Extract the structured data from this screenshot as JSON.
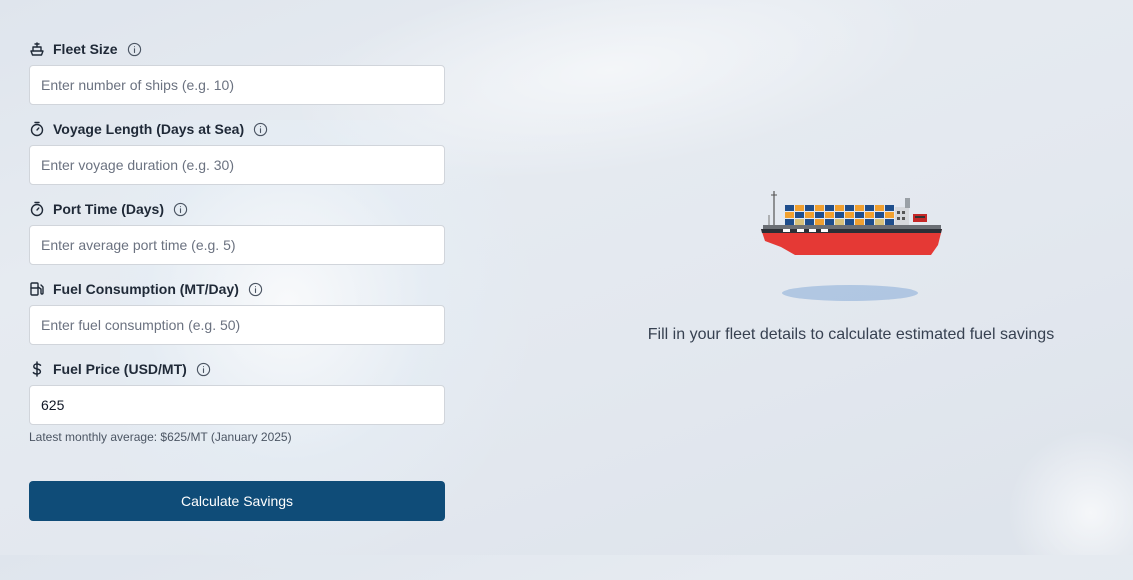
{
  "form": {
    "fleet_size": {
      "label": "Fleet Size",
      "placeholder": "Enter number of ships (e.g. 10)",
      "value": "",
      "icon": "ship-icon"
    },
    "voyage_length": {
      "label": "Voyage Length (Days at Sea)",
      "placeholder": "Enter voyage duration (e.g. 30)",
      "value": "",
      "icon": "timer-icon"
    },
    "port_time": {
      "label": "Port Time (Days)",
      "placeholder": "Enter average port time (e.g. 5)",
      "value": "",
      "icon": "timer-icon"
    },
    "fuel_consumption": {
      "label": "Fuel Consumption (MT/Day)",
      "placeholder": "Enter fuel consumption (e.g. 50)",
      "value": "",
      "icon": "fuel-pump-icon"
    },
    "fuel_price": {
      "label": "Fuel Price (USD/MT)",
      "placeholder": "",
      "value": "625",
      "icon": "dollar-icon"
    },
    "fuel_price_hint": "Latest monthly average: $625/MT (January 2025)",
    "submit_label": "Calculate Savings"
  },
  "results": {
    "empty_message": "Fill in your fleet details to calculate estimated fuel savings"
  },
  "colors": {
    "button": "#0f4c78",
    "ship_hull": "#e53935"
  }
}
